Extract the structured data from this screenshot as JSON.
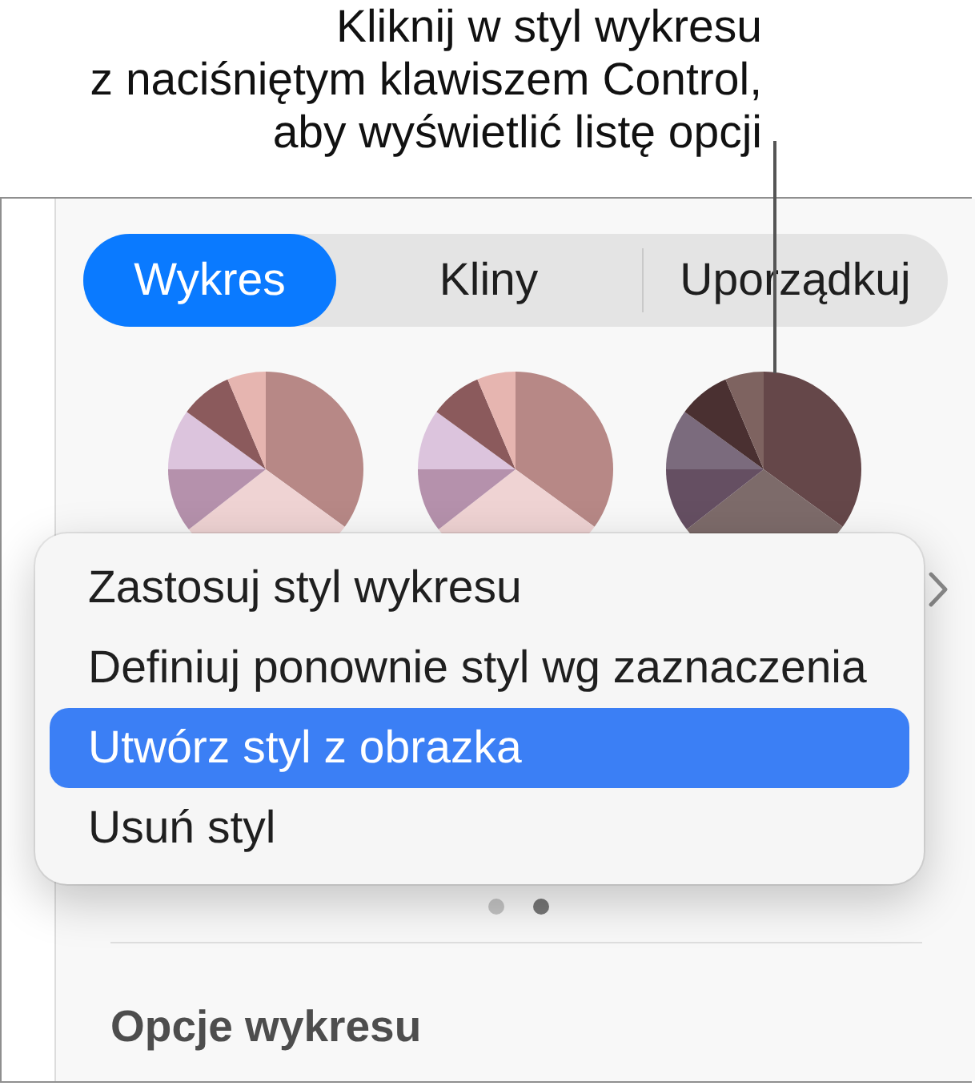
{
  "callout": {
    "text": "Kliknij w styl wykresu\nz naciśniętym klawiszem Control,\naby wyświetlić listę opcji"
  },
  "tabs": [
    {
      "label": "Wykres",
      "selected": true
    },
    {
      "label": "Kliny",
      "selected": false
    },
    {
      "label": "Uporządkuj",
      "selected": false
    }
  ],
  "chart_styles": [
    {
      "slices": [
        {
          "color": "#b78886"
        },
        {
          "color": "#efd3d3"
        },
        {
          "color": "#b591ac"
        },
        {
          "color": "#dcc4dd"
        },
        {
          "color": "#8b5a5c"
        },
        {
          "color": "#e6b5b0"
        }
      ]
    },
    {
      "slices": [
        {
          "color": "#b78886"
        },
        {
          "color": "#efd3d3"
        },
        {
          "color": "#b591ac"
        },
        {
          "color": "#dcc4dd"
        },
        {
          "color": "#8b5a5c"
        },
        {
          "color": "#e6b5b0"
        }
      ]
    },
    {
      "slices": [
        {
          "color": "#654749"
        },
        {
          "color": "#7d6b6a"
        },
        {
          "color": "#654f62"
        },
        {
          "color": "#7b6b7d"
        },
        {
          "color": "#4a3031"
        },
        {
          "color": "#7e6360"
        }
      ]
    }
  ],
  "context_menu": {
    "items": [
      {
        "label": "Zastosuj styl wykresu",
        "selected": false
      },
      {
        "label": "Definiuj ponownie styl wg zaznaczenia",
        "selected": false
      },
      {
        "label": "Utwórz styl z obrazka",
        "selected": true
      },
      {
        "label": "Usuń styl",
        "selected": false
      }
    ]
  },
  "page_dots": [
    {
      "selected": false
    },
    {
      "selected": true
    }
  ],
  "section": {
    "title": "Opcje wykresu"
  }
}
